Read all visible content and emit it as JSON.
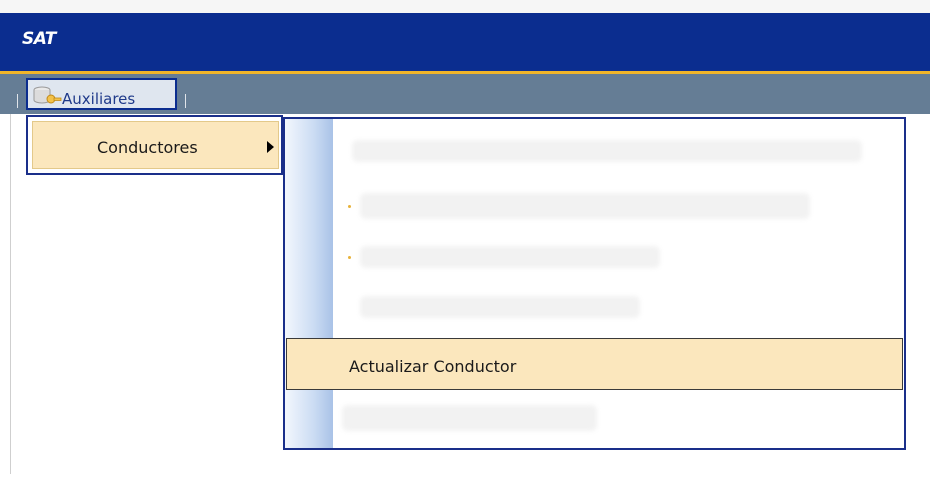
{
  "app": {
    "logo": "SAT"
  },
  "menubar": {
    "items": [
      {
        "label": "Auxiliares",
        "icon": "database-key-icon"
      }
    ]
  },
  "submenu": {
    "items": [
      {
        "label": "Conductores",
        "has_submenu": true
      }
    ]
  },
  "conductores_submenu": {
    "highlighted_item": {
      "label": "Actualizar Conductor"
    }
  },
  "colors": {
    "header": "#0b2d8f",
    "accent_line": "#f0b52a",
    "menubar": "#657d95",
    "highlight": "#fbe7bd",
    "menu_border": "#1a2f8a"
  }
}
